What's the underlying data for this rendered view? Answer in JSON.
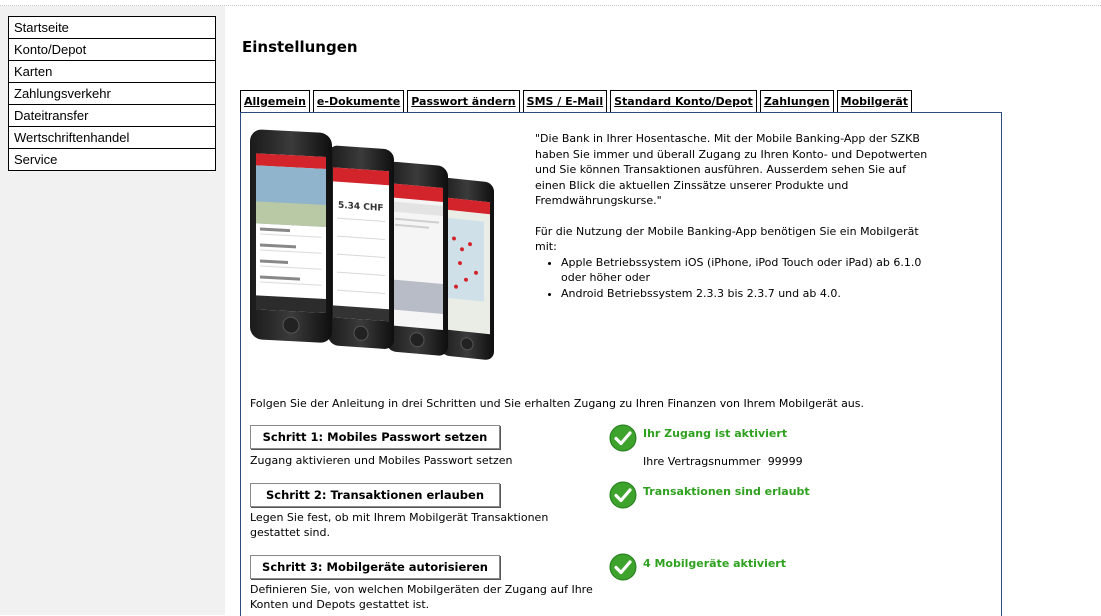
{
  "nav": {
    "items": [
      {
        "label": "Startseite"
      },
      {
        "label": "Konto/Depot"
      },
      {
        "label": "Karten"
      },
      {
        "label": "Zahlungsverkehr"
      },
      {
        "label": "Dateitransfer"
      },
      {
        "label": "Wertschriftenhandel"
      },
      {
        "label": "Service"
      }
    ]
  },
  "page": {
    "title": "Einstellungen"
  },
  "tabs": [
    {
      "label": "Allgemein"
    },
    {
      "label": "e-Dokumente"
    },
    {
      "label": "Passwort ändern"
    },
    {
      "label": "SMS / E-Mail"
    },
    {
      "label": "Standard Konto/Depot"
    },
    {
      "label": "Zahlungen"
    },
    {
      "label": "Mobilgerät",
      "active": true
    }
  ],
  "intro": {
    "quote": "\"Die Bank in Ihrer Hosentasche. Mit der Mobile Banking-App der SZKB haben Sie immer und überall Zugang zu Ihren Konto- und Depotwerten und Sie können Transaktionen ausführen. Ausserdem sehen Sie auf einen Blick die aktuellen Zinssätze unserer Produkte und Fremdwährungskurse.\"",
    "requirements_intro": "Für die Nutzung der Mobile Banking-App benötigen Sie ein Mobilgerät mit:",
    "requirements": [
      "Apple Betriebssystem iOS (iPhone, iPod Touch oder iPad) ab 6.1.0 oder höher oder",
      "Android Betriebssystem 2.3.3 bis 2.3.7 und ab 4.0."
    ]
  },
  "phones_image": {
    "balance": "5.34 CHF",
    "brand_color": "#d3242b"
  },
  "follow_text": "Folgen Sie der Anleitung in drei Schritten und Sie erhalten Zugang zu Ihren Finanzen von Ihrem Mobilgerät aus.",
  "steps": [
    {
      "button": "Schritt 1: Mobiles Passwort setzen",
      "description": "Zugang aktivieren und Mobiles Passwort setzen",
      "status": "Ihr Zugang ist aktiviert",
      "contract_label": "Ihre Vertragsnummer",
      "contract_number": "99999"
    },
    {
      "button": "Schritt 2: Transaktionen erlauben",
      "description": "Legen Sie fest, ob mit Ihrem Mobilgerät Transaktionen gestattet sind.",
      "status": "Transaktionen sind erlaubt"
    },
    {
      "button": "Schritt 3: Mobilgeräte autorisieren",
      "description": "Definieren Sie, von welchen Mobilgeräten der Zugang auf Ihre Konten und Depots gestattet ist.",
      "status": "4 Mobilgeräte aktiviert"
    }
  ],
  "colors": {
    "status_green": "#2ea11f",
    "panel_border": "#2d4b7a",
    "sidebar_bg": "#f1f1f1"
  }
}
